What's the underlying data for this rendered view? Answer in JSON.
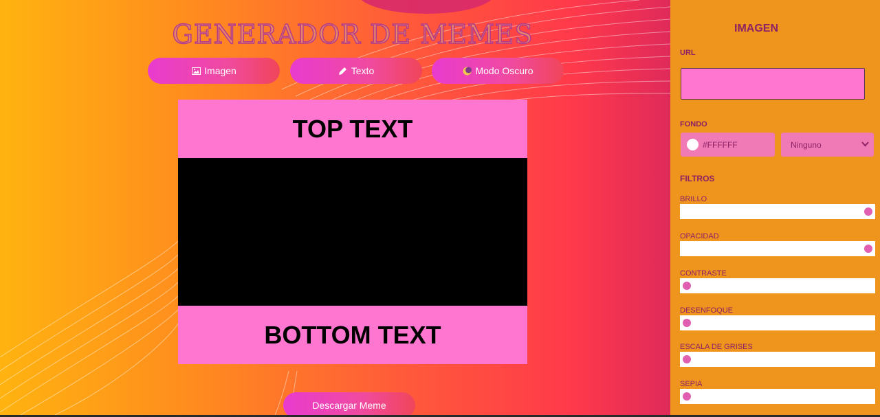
{
  "app": {
    "title": "GENERADOR DE MEMES"
  },
  "nav": {
    "image_label": "Imagen",
    "text_label": "Texto",
    "dark_label": "Modo Oscuro"
  },
  "meme": {
    "top_text": "TOP TEXT",
    "bottom_text": "BOTTOM TEXT"
  },
  "actions": {
    "download_label": "Descargar Meme"
  },
  "panel": {
    "title": "IMAGEN",
    "url_label": "URL",
    "url_value": "",
    "background_label": "FONDO",
    "background_color": "#FFFFFF",
    "blend_mode": "Ninguno",
    "filters_label": "FILTROS",
    "filters": [
      {
        "label": "BRILLO",
        "value": 1
      },
      {
        "label": "OPACIDAD",
        "value": 1
      },
      {
        "label": "CONTRASTE",
        "value": 0
      },
      {
        "label": "DESENFOQUE",
        "value": 0
      },
      {
        "label": "ESCALA DE GRISES",
        "value": 0
      },
      {
        "label": "SEPIA",
        "value": 0
      }
    ]
  },
  "colors": {
    "accent_pink": "#ff76d1",
    "panel_orange": "#ef941d",
    "panel_text": "#8c2166"
  },
  "icons": [
    "image-icon",
    "pencil-icon",
    "moon-icon",
    "chevron-down-icon"
  ]
}
